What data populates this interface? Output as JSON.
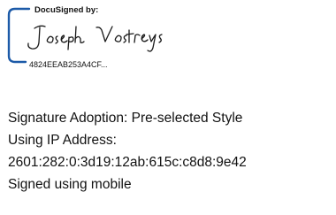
{
  "signature_block": {
    "header": "DocuSigned by:",
    "signer_name_handwritten": "Joseph Vostreys",
    "envelope_id": "4824EEAB253A4CF...",
    "bracket_color": "#1c5aa8"
  },
  "details": {
    "adoption": "Signature Adoption: Pre-selected Style",
    "ip_label": "Using IP Address:",
    "ip_address": "2601:282:0:3d19:12ab:615c:c8d8:9e42",
    "method": "Signed using mobile"
  }
}
